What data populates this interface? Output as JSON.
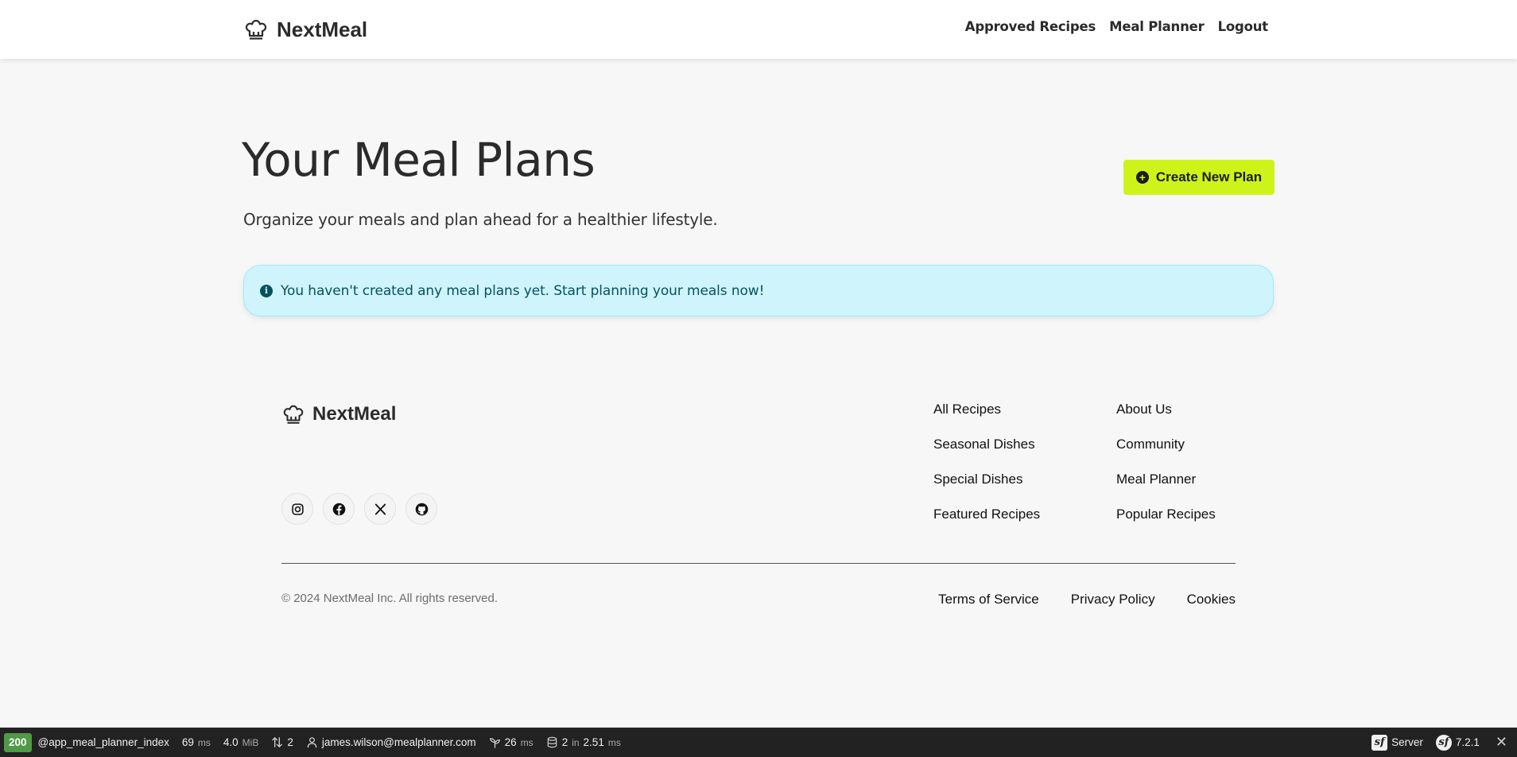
{
  "header": {
    "brand": "NextMeal",
    "nav": [
      "Approved Recipes",
      "Meal Planner",
      "Logout"
    ]
  },
  "main": {
    "title": "Your Meal Plans",
    "subtitle": "Organize your meals and plan ahead for a healthier lifestyle.",
    "create_button": "Create New Plan",
    "alert": "You haven't created any meal plans yet. Start planning your meals now!"
  },
  "footer": {
    "brand": "NextMeal",
    "socials": [
      "instagram-icon",
      "facebook-icon",
      "x-icon",
      "github-icon"
    ],
    "col1": [
      "All Recipes",
      "Seasonal Dishes",
      "Special Dishes",
      "Featured Recipes"
    ],
    "col2": [
      "About Us",
      "Community",
      "Meal Planner",
      "Popular Recipes"
    ],
    "copyright": "© 2024 NextMeal Inc. All rights reserved.",
    "legal": [
      "Terms of Service",
      "Privacy Policy",
      "Cookies"
    ]
  },
  "toolbar": {
    "status": "200",
    "route": "@app_meal_planner_index",
    "time": "69",
    "time_unit": "ms",
    "memory": "4.0",
    "memory_unit": "MiB",
    "requests": "2",
    "user": "james.wilson@mealplanner.com",
    "twig_time": "26",
    "twig_unit": "ms",
    "db_queries": "2",
    "db_in": "in",
    "db_time": "2.51",
    "db_unit": "ms",
    "server": "Server",
    "version": "7.2.1"
  },
  "colors": {
    "accent": "#cdf31a",
    "alert_bg": "#cff4fc",
    "alert_text": "#055160",
    "status_ok": "#4f9a45"
  }
}
